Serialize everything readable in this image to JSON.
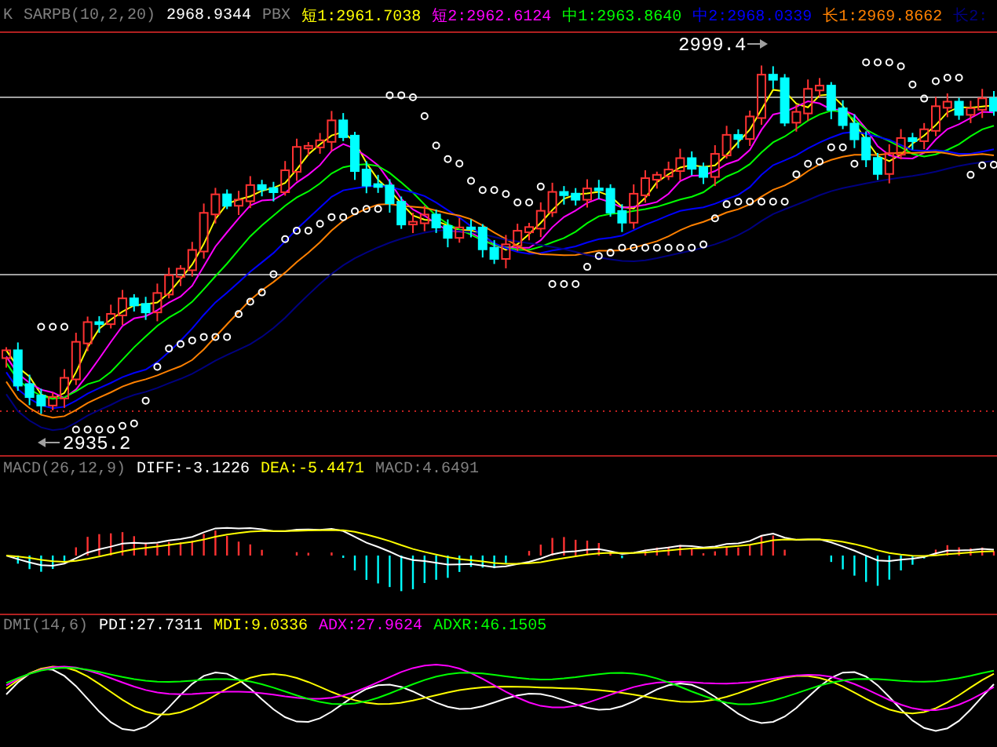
{
  "price_panel": {
    "legend": [
      {
        "text": "K",
        "color": "#808080"
      },
      {
        "text": "SARPB(10,2,20)",
        "color": "#808080"
      },
      {
        "text": "2968.9344",
        "color": "#ffffff"
      },
      {
        "text": "PBX",
        "color": "#808080"
      },
      {
        "text": "短1:2961.7038",
        "color": "#ffff00"
      },
      {
        "text": "短2:2962.6124",
        "color": "#ff00ff"
      },
      {
        "text": "中1:2963.8640",
        "color": "#00ff00"
      },
      {
        "text": "中2:2968.0339",
        "color": "#0000ff"
      },
      {
        "text": "长1:2969.8662",
        "color": "#ff8000"
      },
      {
        "text": "长2:",
        "color": "#000080"
      }
    ],
    "high_label": "2999.4",
    "low_label": "2935.2"
  },
  "macd_panel": {
    "legend": [
      {
        "text": "MACD(26,12,9)",
        "color": "#808080"
      },
      {
        "text": "DIFF:-3.1226",
        "color": "#ffffff"
      },
      {
        "text": "DEA:-5.4471",
        "color": "#ffff00"
      },
      {
        "text": "MACD:4.6491",
        "color": "#808080"
      }
    ]
  },
  "dmi_panel": {
    "legend": [
      {
        "text": "DMI(14,6)",
        "color": "#808080"
      },
      {
        "text": "PDI:27.7311",
        "color": "#ffffff"
      },
      {
        "text": "MDI:9.0336",
        "color": "#ffff00"
      },
      {
        "text": "ADX:27.9624",
        "color": "#ff00ff"
      },
      {
        "text": "ADXR:46.1505",
        "color": "#00ff00"
      }
    ]
  }
}
